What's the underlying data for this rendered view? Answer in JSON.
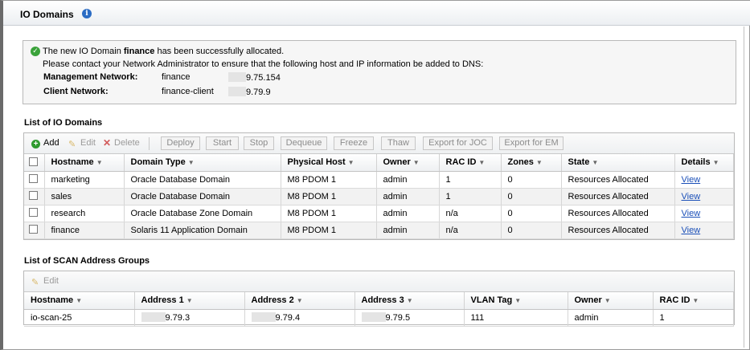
{
  "header": {
    "title": "IO Domains"
  },
  "message": {
    "line1_prefix": "The new IO Domain ",
    "line1_domain": "finance",
    "line1_suffix": " has been successfully allocated.",
    "line2": "Please contact your Network Administrator to ensure that the following host and IP information be added to DNS:",
    "networks": [
      {
        "label": "Management Network:",
        "name": "finance",
        "ip": "9.75.154"
      },
      {
        "label": "Client Network:",
        "name": "finance-client",
        "ip": "9.79.9"
      }
    ]
  },
  "io_domains": {
    "title": "List of IO Domains",
    "toolbar": {
      "add": "Add",
      "edit": "Edit",
      "delete": "Delete",
      "deploy": "Deploy",
      "start": "Start",
      "stop": "Stop",
      "dequeue": "Dequeue",
      "freeze": "Freeze",
      "thaw": "Thaw",
      "export_joc": "Export for JOC",
      "export_em": "Export for EM"
    },
    "columns": [
      "Hostname",
      "Domain Type",
      "Physical Host",
      "Owner",
      "RAC ID",
      "Zones",
      "State",
      "Details"
    ],
    "rows": [
      [
        "marketing",
        "Oracle Database Domain",
        "M8 PDOM 1",
        "admin",
        "1",
        "0",
        "Resources Allocated",
        "View"
      ],
      [
        "sales",
        "Oracle Database Domain",
        "M8 PDOM 1",
        "admin",
        "1",
        "0",
        "Resources Allocated",
        "View"
      ],
      [
        "research",
        "Oracle Database Zone Domain",
        "M8 PDOM 1",
        "admin",
        "n/a",
        "0",
        "Resources Allocated",
        "View"
      ],
      [
        "finance",
        "Solaris 11 Application Domain",
        "M8 PDOM 1",
        "admin",
        "n/a",
        "0",
        "Resources Allocated",
        "View"
      ]
    ]
  },
  "scan_groups": {
    "title": "List of SCAN Address Groups",
    "toolbar": {
      "edit": "Edit"
    },
    "columns": [
      "Hostname",
      "Address 1",
      "Address 2",
      "Address 3",
      "VLAN Tag",
      "Owner",
      "RAC ID"
    ],
    "rows": [
      [
        "io-scan-25",
        "9.79.3",
        "9.79.4",
        "9.79.5",
        "111",
        "admin",
        "1"
      ]
    ]
  }
}
